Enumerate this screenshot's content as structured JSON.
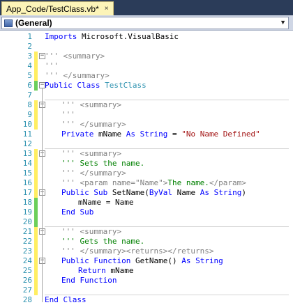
{
  "tab": {
    "title": "App_Code/TestClass.vb*",
    "close": "×"
  },
  "nav": {
    "selected": "(General)",
    "arrow": "▼"
  },
  "lines": [
    {
      "n": "1",
      "parts": [
        [
          "kw",
          "Imports"
        ],
        [
          "plain",
          " Microsoft.VisualBasic"
        ]
      ]
    },
    {
      "n": "2",
      "parts": []
    },
    {
      "n": "3",
      "parts": [
        [
          "xml",
          "''' <summary>"
        ]
      ]
    },
    {
      "n": "4",
      "parts": [
        [
          "xml",
          "'''"
        ]
      ]
    },
    {
      "n": "5",
      "parts": [
        [
          "xml",
          "''' </summary>"
        ]
      ]
    },
    {
      "n": "6",
      "parts": [
        [
          "kw",
          "Public Class"
        ],
        [
          "plain",
          " "
        ],
        [
          "typ",
          "TestClass"
        ]
      ]
    },
    {
      "n": "7",
      "parts": []
    },
    {
      "n": "8",
      "parts": [
        [
          "xml",
          "''' <summary>"
        ]
      ]
    },
    {
      "n": "9",
      "parts": [
        [
          "xml",
          "'''"
        ]
      ]
    },
    {
      "n": "10",
      "parts": [
        [
          "xml",
          "''' </summary>"
        ]
      ]
    },
    {
      "n": "11",
      "parts": [
        [
          "kw",
          "Private"
        ],
        [
          "plain",
          " mName "
        ],
        [
          "kw",
          "As String"
        ],
        [
          "plain",
          " = "
        ],
        [
          "str",
          "\"No Name Defined\""
        ]
      ]
    },
    {
      "n": "12",
      "parts": []
    },
    {
      "n": "13",
      "parts": [
        [
          "xml",
          "''' <summary>"
        ]
      ]
    },
    {
      "n": "14",
      "parts": [
        [
          "cm",
          "''' Sets the name."
        ]
      ]
    },
    {
      "n": "15",
      "parts": [
        [
          "xml",
          "''' </summary>"
        ]
      ]
    },
    {
      "n": "16",
      "parts": [
        [
          "xml",
          "''' <param name=\"Name\">"
        ],
        [
          "cm",
          "The name."
        ],
        [
          "xml",
          "</param>"
        ]
      ]
    },
    {
      "n": "17",
      "parts": [
        [
          "kw",
          "Public Sub"
        ],
        [
          "plain",
          " SetName("
        ],
        [
          "kw",
          "ByVal"
        ],
        [
          "plain",
          " Name "
        ],
        [
          "kw",
          "As String"
        ],
        [
          "plain",
          ")"
        ]
      ]
    },
    {
      "n": "18",
      "parts": [
        [
          "plain",
          "mName = Name"
        ]
      ]
    },
    {
      "n": "19",
      "parts": [
        [
          "kw",
          "End Sub"
        ]
      ]
    },
    {
      "n": "20",
      "parts": []
    },
    {
      "n": "21",
      "parts": [
        [
          "xml",
          "''' <summary>"
        ]
      ]
    },
    {
      "n": "22",
      "parts": [
        [
          "cm",
          "''' Gets the name."
        ]
      ]
    },
    {
      "n": "23",
      "parts": [
        [
          "xml",
          "''' </summary><returns></returns>"
        ]
      ]
    },
    {
      "n": "24",
      "parts": [
        [
          "kw",
          "Public Function"
        ],
        [
          "plain",
          " GetName() "
        ],
        [
          "kw",
          "As String"
        ]
      ]
    },
    {
      "n": "25",
      "parts": [
        [
          "kw",
          "Return"
        ],
        [
          "plain",
          " mName"
        ]
      ]
    },
    {
      "n": "26",
      "parts": [
        [
          "kw",
          "End Function"
        ]
      ]
    },
    {
      "n": "27",
      "parts": []
    },
    {
      "n": "28",
      "parts": [
        [
          "kw",
          "End Class"
        ]
      ]
    }
  ],
  "colors": {
    "keyword": "#0000ff",
    "comment": "#008000",
    "xmldoc": "#808080",
    "string": "#a31515",
    "type": "#2b91af",
    "changed": "#ffee62",
    "saved": "#6ccf5a"
  },
  "icons": {
    "collapse": "−"
  }
}
